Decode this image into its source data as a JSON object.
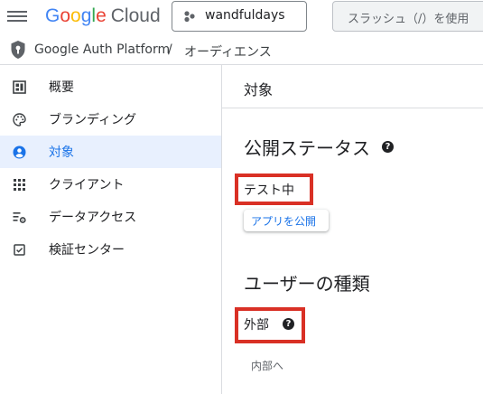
{
  "header": {
    "logo": {
      "letters": [
        "G",
        "o",
        "o",
        "g",
        "l",
        "e"
      ],
      "colors": [
        "#4285F4",
        "#EA4335",
        "#FBBC05",
        "#4285F4",
        "#34A853",
        "#EA4335"
      ],
      "product": "Cloud"
    },
    "project": "wandfuldays",
    "search_placeholder": "スラッシュ（/）を使用"
  },
  "breadcrumb": {
    "product": "Google Auth Platform",
    "separator": "/",
    "page": "オーディエンス"
  },
  "sidebar": {
    "items": [
      {
        "label": "概要",
        "icon": "dashboard-icon",
        "active": false
      },
      {
        "label": "ブランディング",
        "icon": "palette-icon",
        "active": false
      },
      {
        "label": "対象",
        "icon": "account-circle-icon",
        "active": true
      },
      {
        "label": "クライアント",
        "icon": "apps-grid-icon",
        "active": false
      },
      {
        "label": "データアクセス",
        "icon": "data-settings-icon",
        "active": false
      },
      {
        "label": "検証センター",
        "icon": "checkbox-icon",
        "active": false
      }
    ]
  },
  "main": {
    "title": "対象",
    "publishing_status": {
      "heading": "公開ステータス",
      "value": "テスト中",
      "button": "アプリを公開"
    },
    "user_type": {
      "heading": "ユーザーの種類",
      "value": "外部",
      "link": "内部へ"
    }
  },
  "colors": {
    "accent": "#1a73e8",
    "active_bg": "#e8f0fe",
    "highlight": "#d93025"
  }
}
